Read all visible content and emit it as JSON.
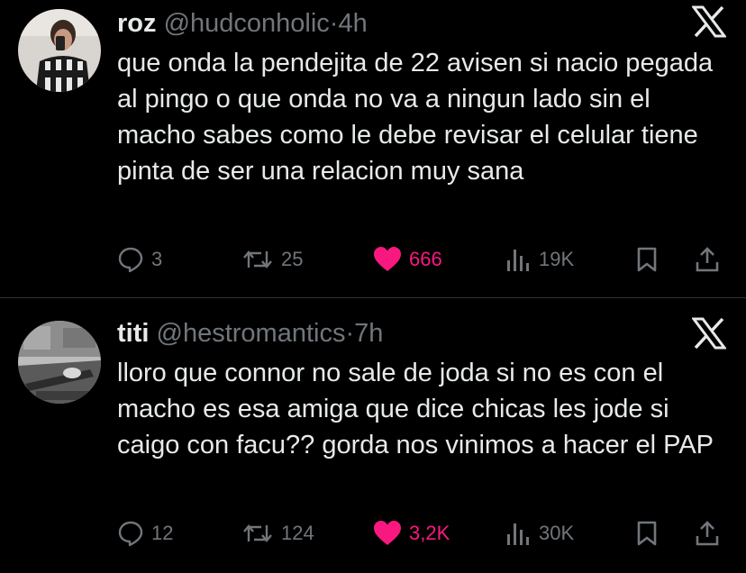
{
  "accent_like_color": "#f91880",
  "muted_color": "#71767b",
  "tweets": [
    {
      "name": "roz",
      "handle": "@hudconholic",
      "dot": "·",
      "time": "4h",
      "text": "que onda la pendejita de 22 avisen si nacio pegada al pingo o que onda no va a ningun lado sin el macho sabes como le debe revisar el celular tiene pinta de ser una relacion muy sana",
      "replies": "3",
      "retweets": "25",
      "likes": "666",
      "views": "19K",
      "platform_icon": "x-logo-icon"
    },
    {
      "name": "titi",
      "handle": "@hestromantics",
      "dot": "·",
      "time": "7h",
      "text": "lloro que connor no sale de joda si no es con el macho es esa amiga que dice chicas les jode si caigo con facu?? gorda nos vinimos a hacer el PAP",
      "replies": "12",
      "retweets": "124",
      "likes": "3,2K",
      "views": "30K",
      "platform_icon": "x-logo-icon"
    }
  ]
}
